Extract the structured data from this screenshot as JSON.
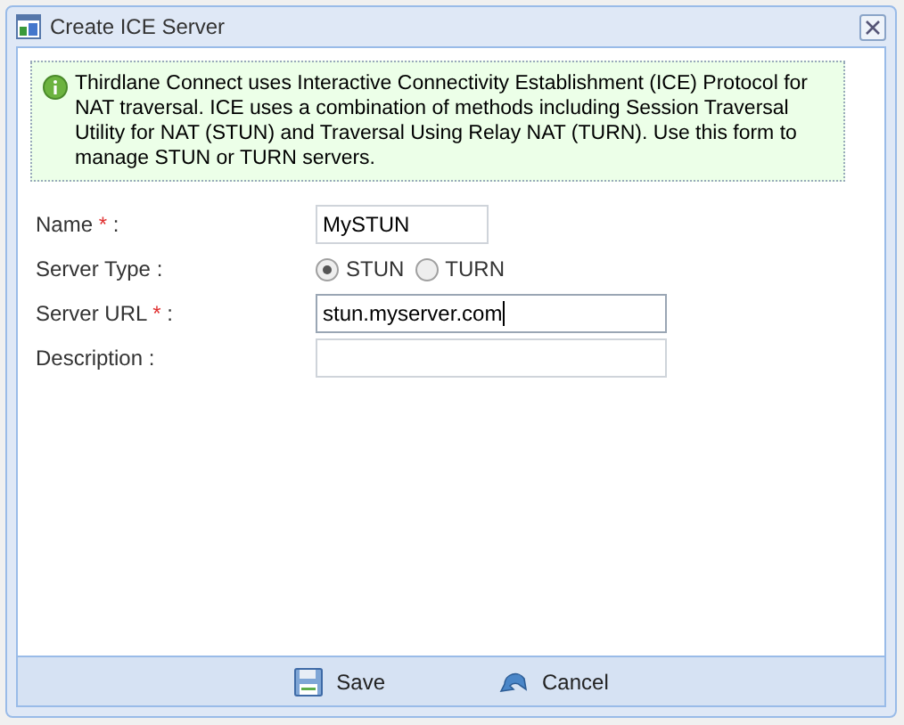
{
  "window": {
    "title": "Create ICE Server"
  },
  "info": {
    "text": "Thirdlane Connect uses Interactive Connectivity Establishment (ICE) Protocol for NAT traversal. ICE uses a combination of methods including Session Traversal Utility for NAT (STUN) and Traversal Using Relay NAT (TURN). Use this form to manage STUN or TURN servers."
  },
  "fields": [
    {
      "kind": "short_text",
      "label": "Name",
      "required_mark": "*",
      "suffix": ":",
      "value": "MySTUN",
      "focused": false
    },
    {
      "kind": "radio",
      "label": "Server Type",
      "suffix": ":",
      "options": [
        {
          "label": "STUN",
          "selected": true
        },
        {
          "label": "TURN",
          "selected": false
        }
      ]
    },
    {
      "kind": "text",
      "label": "Server URL",
      "required_mark": "*",
      "suffix": ":",
      "value": "stun.myserver.com",
      "focused": true
    },
    {
      "kind": "text",
      "label": "Description",
      "suffix": ":",
      "focused": false
    }
  ],
  "buttons": [
    {
      "kind": "save",
      "label": "Save"
    },
    {
      "kind": "cancel",
      "label": "Cancel"
    }
  ]
}
